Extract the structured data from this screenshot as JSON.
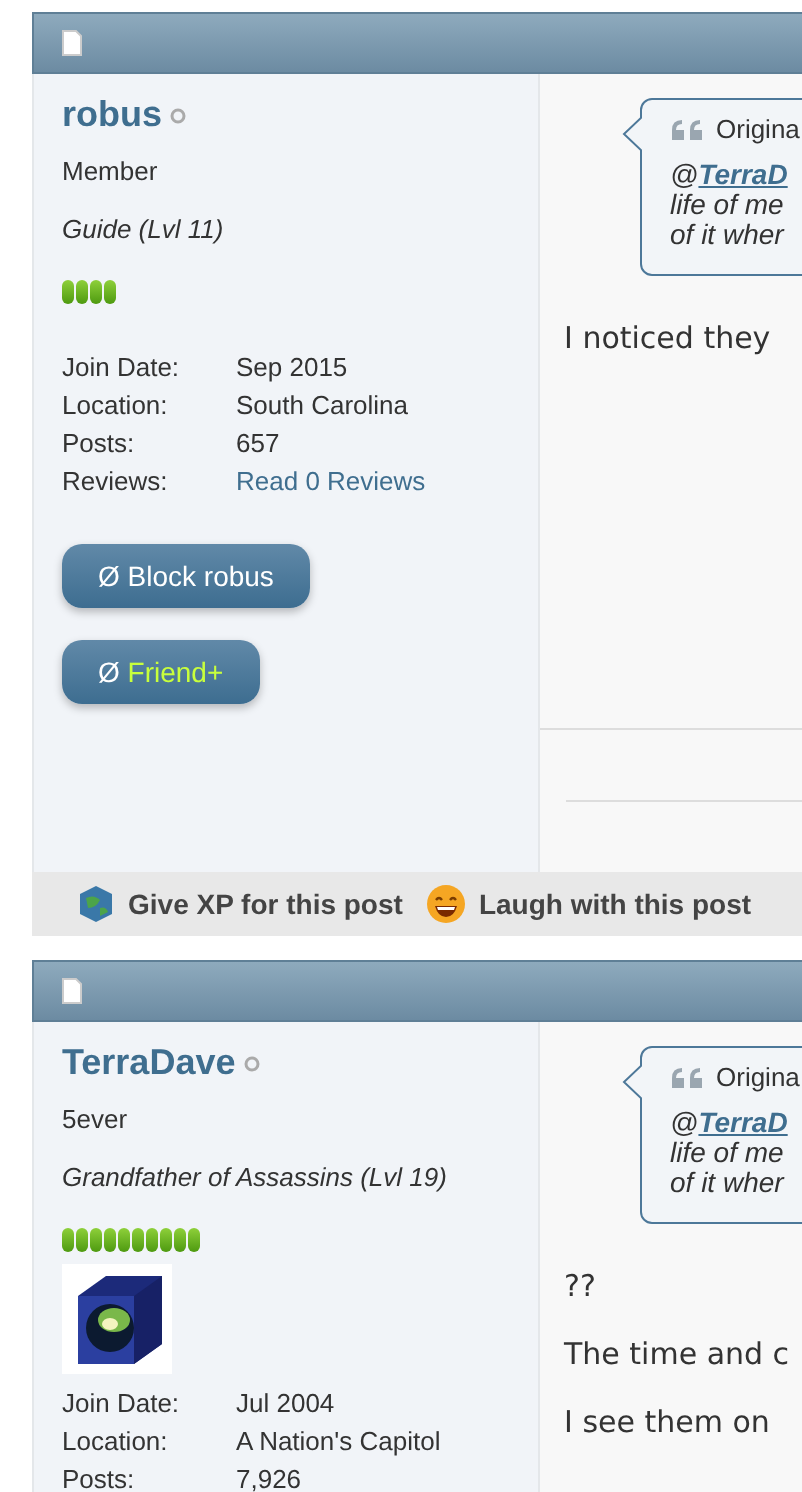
{
  "posts": [
    {
      "user": {
        "name": "robus",
        "online": false,
        "rank": "Member",
        "title": "Guide (Lvl 11)",
        "stars": 4,
        "info": [
          {
            "label": "Join Date:",
            "value": "Sep 2015",
            "link": false
          },
          {
            "label": "Location:",
            "value": "South Carolina",
            "link": false
          },
          {
            "label": "Posts:",
            "value": "657",
            "link": false
          },
          {
            "label": "Reviews:",
            "value": "Read 0 Reviews",
            "link": true
          }
        ],
        "buttons": [
          {
            "kind": "block",
            "icon": "Ø",
            "label": "Block robus"
          },
          {
            "kind": "friend",
            "icon": "Ø",
            "label": "Friend+"
          }
        ]
      },
      "quote": {
        "header": "Origina",
        "mention": "@**TerraD**",
        "lines": [
          "life of me",
          "of it wher"
        ]
      },
      "paragraphs": [
        "I noticed they"
      ],
      "dividers": true,
      "actions": [
        {
          "kind": "xp",
          "label": "Give XP for this post"
        },
        {
          "kind": "laugh",
          "label": "Laugh with this post"
        }
      ]
    },
    {
      "user": {
        "name": "TerraDave",
        "online": false,
        "rank": "5ever",
        "title": "Grandfather of Assassins (Lvl 19)",
        "stars": 10,
        "avatar": true,
        "info": [
          {
            "label": "Join Date:",
            "value": "Jul 2004",
            "link": false
          },
          {
            "label": "Location:",
            "value": "A Nation's Capitol",
            "link": false
          },
          {
            "label": "Posts:",
            "value": "7,926",
            "link": false
          }
        ]
      },
      "quote": {
        "header": "Origina",
        "mention": "@**TerraD**",
        "lines": [
          "life of me",
          "of it wher"
        ]
      },
      "paragraphs": [
        "??",
        "The time and c",
        "I see them on"
      ]
    }
  ]
}
